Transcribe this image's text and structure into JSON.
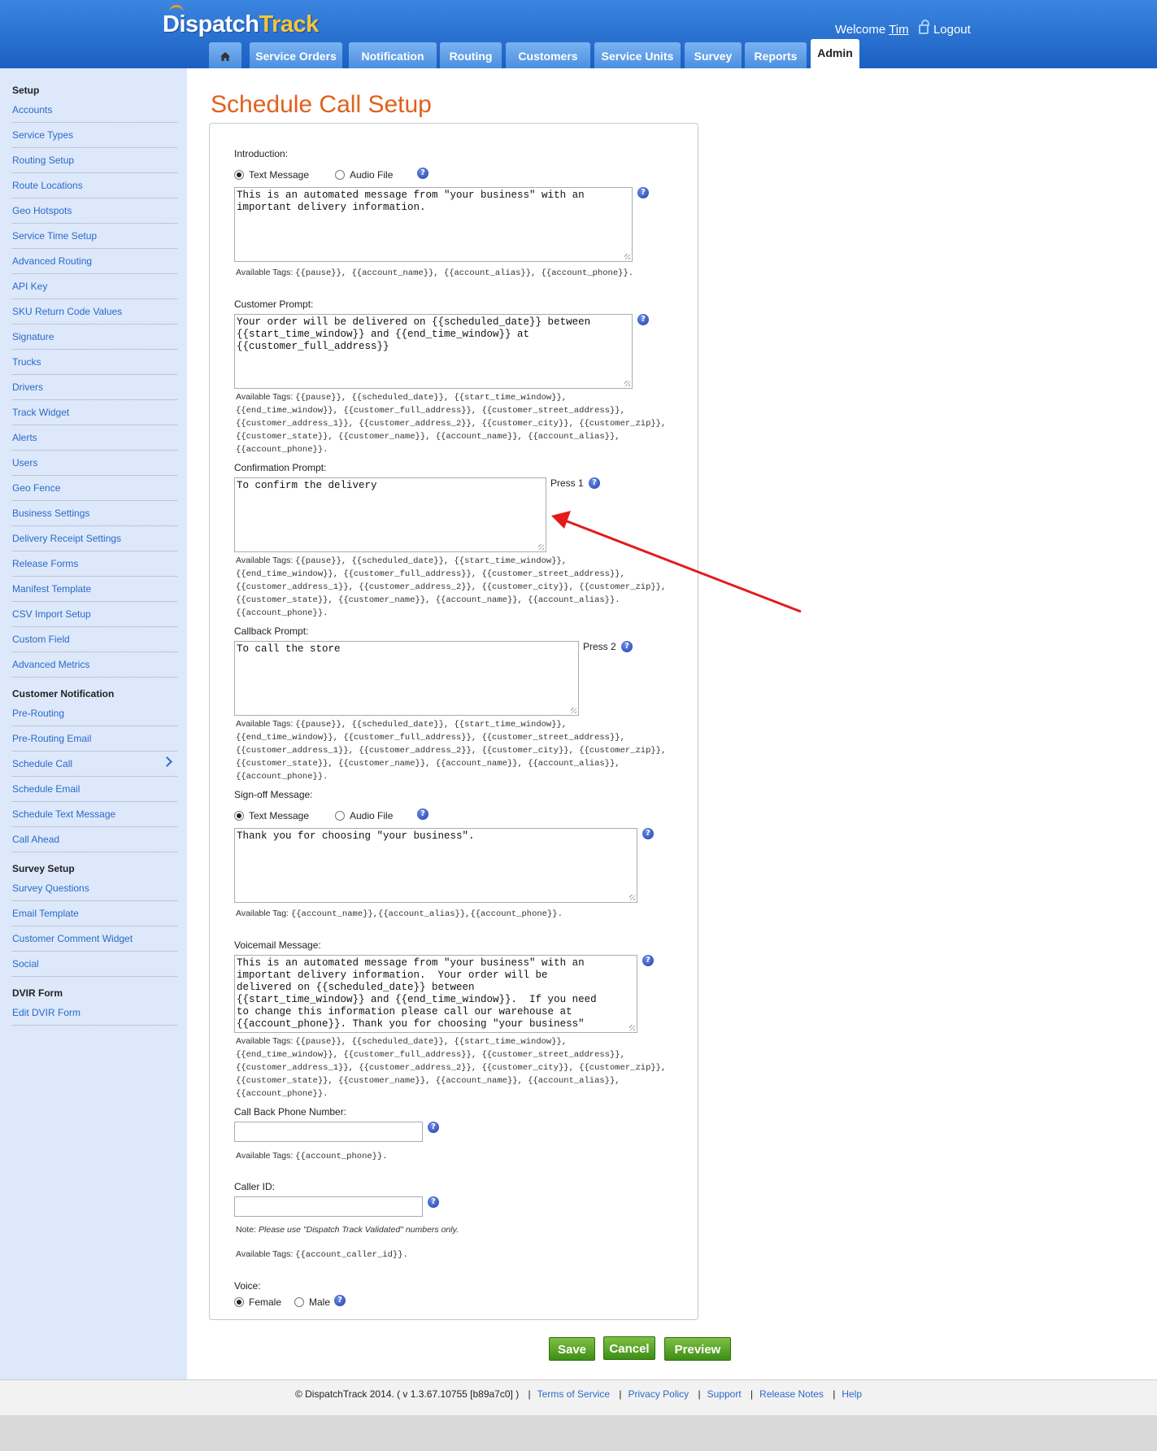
{
  "brand": {
    "logo_part1": "Dispatch",
    "logo_part2": "Track"
  },
  "header": {
    "welcome": "Welcome",
    "user": "Tim",
    "logout": "Logout"
  },
  "tabs": [
    {
      "label": ""
    },
    {
      "label": "Service Orders"
    },
    {
      "label": "Notification"
    },
    {
      "label": "Routing"
    },
    {
      "label": "Customers"
    },
    {
      "label": "Service Units"
    },
    {
      "label": "Survey"
    },
    {
      "label": "Reports"
    },
    {
      "label": "Admin"
    }
  ],
  "sidebar": {
    "setup_title": "Setup",
    "setup_items": [
      "Accounts",
      "Service Types",
      "Routing Setup",
      "Route Locations",
      "Geo Hotspots",
      "Service Time Setup",
      "Advanced Routing",
      "API Key",
      "SKU Return Code Values",
      "Signature",
      "Trucks",
      "Drivers",
      "Track Widget",
      "Alerts",
      "Users",
      "Geo Fence",
      "Business Settings",
      "Delivery Receipt Settings",
      "Release Forms",
      "Manifest Template",
      "CSV Import Setup",
      "Custom Field",
      "Advanced Metrics"
    ],
    "notification_title": "Customer Notification",
    "notification_items": [
      "Pre-Routing",
      "Pre-Routing Email",
      "Schedule Call",
      "Schedule Email",
      "Schedule Text Message",
      "Call Ahead"
    ],
    "survey_title": "Survey Setup",
    "survey_items": [
      "Survey Questions",
      "Email Template",
      "Customer Comment Widget",
      "Social"
    ],
    "dvir_title": "DVIR Form",
    "dvir_items": [
      "Edit DVIR Form"
    ]
  },
  "page": {
    "title": "Schedule Call Setup",
    "introduction": {
      "label": "Introduction:",
      "opt_text": "Text Message",
      "opt_audio": "Audio File",
      "selected": "Text Message",
      "value": "This is an automated message from \"your business\" with an\nimportant delivery information.",
      "tags_label": "Available Tags:",
      "tags": "{{pause}}, {{account_name}}, {{account_alias}}, {{account_phone}}."
    },
    "customer_prompt": {
      "label": "Customer Prompt:",
      "value": "Your order will be delivered on {{scheduled_date}} between\n{{start_time_window}} and {{end_time_window}} at\n{{customer_full_address}}",
      "tags_label": "Available Tags:",
      "tags": "{{pause}}, {{scheduled_date}}, {{start_time_window}}, {{end_time_window}}, {{customer_full_address}}, {{customer_street_address}}, {{customer_address_1}}, {{customer_address_2}}, {{customer_city}}, {{customer_zip}}, {{customer_state}}, {{customer_name}}, {{account_name}}, {{account_alias}}, {{account_phone}}."
    },
    "confirmation_prompt": {
      "label": "Confirmation Prompt:",
      "value": "To confirm the delivery",
      "press": "Press 1",
      "tags_label": "Available Tags:",
      "tags": "{{pause}}, {{scheduled_date}}, {{start_time_window}}, {{end_time_window}}, {{customer_full_address}}, {{customer_street_address}}, {{customer_address_1}}, {{customer_address_2}}, {{customer_city}}, {{customer_zip}}, {{customer_state}}, {{customer_name}}, {{account_name}}, {{account_alias}}.{{account_phone}}."
    },
    "callback_prompt": {
      "label": "Callback Prompt:",
      "value": "To call the store",
      "press": "Press 2",
      "tags_label": "Available Tags:",
      "tags": "{{pause}}, {{scheduled_date}}, {{start_time_window}}, {{end_time_window}}, {{customer_full_address}}, {{customer_street_address}}, {{customer_address_1}}, {{customer_address_2}}, {{customer_city}}, {{customer_zip}}, {{customer_state}}, {{customer_name}}, {{account_name}}, {{account_alias}}, {{account_phone}}."
    },
    "signoff": {
      "label": "Sign-off Message:",
      "opt_text": "Text Message",
      "opt_audio": "Audio File",
      "selected": "Text Message",
      "value": "Thank you for choosing \"your business\".",
      "tags_label": "Available Tag:",
      "tags": "{{account_name}},{{account_alias}},{{account_phone}}."
    },
    "voicemail": {
      "label": "Voicemail Message:",
      "value": "This is an automated message from \"your business\" with an\nimportant delivery information.  Your order will be\ndelivered on {{scheduled_date}} between\n{{start_time_window}} and {{end_time_window}}.  If you need\nto change this information please call our warehouse at\n{{account_phone}}. Thank you for choosing \"your business\"",
      "tags_label": "Available Tags:",
      "tags": "{{pause}}, {{scheduled_date}}, {{start_time_window}}, {{end_time_window}}, {{customer_full_address}}, {{customer_street_address}}, {{customer_address_1}}, {{customer_address_2}}, {{customer_city}}, {{customer_zip}}, {{customer_state}}, {{customer_name}}, {{account_name}}, {{account_alias}}, {{account_phone}}."
    },
    "callback_phone": {
      "label": "Call Back Phone Number:",
      "value": "",
      "tags_label": "Available Tags:",
      "tags": "{{account_phone}}."
    },
    "caller_id": {
      "label": "Caller ID:",
      "value": "",
      "note_label": "Note:",
      "note": "Please use \"Dispatch Track Validated\" numbers only.",
      "tags_label": "Available Tags:",
      "tags": "{{account_caller_id}}."
    },
    "voice": {
      "label": "Voice:",
      "opt_female": "Female",
      "opt_male": "Male",
      "selected": "Female"
    },
    "buttons": {
      "save": "Save",
      "cancel": "Cancel",
      "preview": "Preview"
    }
  },
  "footer": {
    "copyright": "© DispatchTrack 2014. ( v 1.3.67.10755 [b89a7c0] )",
    "links": [
      "Terms of Service",
      "Privacy Policy",
      "Support",
      "Release Notes",
      "Help"
    ]
  },
  "colors": {
    "header_blue": "#1b5fc2",
    "title_orange": "#e2601b",
    "link_blue": "#2a6ac7",
    "button_green": "#4e9a1f",
    "annotation_arrow": "#e31b1b"
  }
}
